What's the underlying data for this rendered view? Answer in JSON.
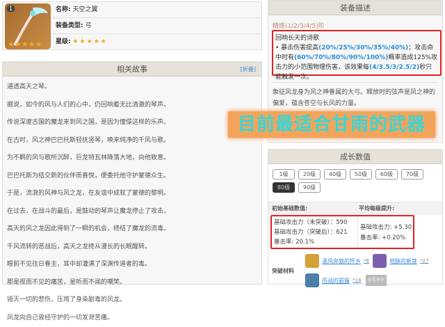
{
  "info": {
    "level_badge": "1",
    "name_label": "名称:",
    "name": "天空之翼",
    "type_label": "装备类型:",
    "type": "弓",
    "star_label": "星级:",
    "stars": "★★★★★",
    "icon": "sky-wing-bow-icon"
  },
  "story": {
    "title": "相关故事",
    "fold": "[折叠]",
    "lines": [
      "通透高天之琴。",
      "据说，如今的风与人们的心中，仍回响着无比清澈的琴声。",
      "传说深邃古国的魔龙来到风之国，是因为憧憬这样的乐声。",
      "在古时，风之神巴巴托斯轻抚竖琴，唤来纯净的千风与歌。",
      "为不羁的风与歌所沉醉，巨龙特瓦林降落大地，向他致意。",
      "巴巴托斯为结交新的伙伴而喜悦，便委托他守护蒙德众生。",
      "于是，流浪的风神与风之龙，在友谊中成就了蒙德的黎明。",
      "在过去，在战斗的最后，是鼓动的琴声让魔龙停止了攻击，",
      "高天的风之龙因此得到了一瞬的机会，终结了魔龙的流毒。",
      "千风流转的恶战后，高天之龙终从漫长的长眠醒转。",
      "眼前不见往日眷主，耳中却灌满了深渊传道者的毒。",
      "那是视而不见的痛苦，是听而不闻的嘲笑。",
      "毁灭一切的悲伤，压垮了身染剧毒的风龙。",
      "风龙向自己曾经守护的一切发泄苦痛。"
    ]
  },
  "desc": {
    "title": "装备描述",
    "refine": "精炼(1/2/3/4/5)阶",
    "skill_name": "回响长天的诗歌",
    "t1": "• 暴击伤害提高",
    "v1": "(20%/25%/30%/35%/40%)",
    "t2": "；攻击命中时有",
    "v2": "(60%/70%/80%/90%/100%)",
    "t3": "概率造成125%攻击力的小范围物理伤害，该效果每",
    "v3": "(4/3.5/3/2.5/2)",
    "t4": "秒只能触发一次。",
    "lore": "象征风龙身为风之神眷属的大弓。释放时的弦声是风之神的偏爱，蕴含苍空与长风的力量。"
  },
  "banner": "目前最适合甘雨的武器",
  "growth": {
    "title": "成长数值",
    "levels": [
      "1级",
      "20级",
      "40级",
      "50级",
      "60级",
      "70级",
      "80级",
      "90级"
    ],
    "selected": "80级",
    "base_header": "初始基础数值:",
    "avg_header": "平均每级提升:",
    "base": [
      "基础攻击力（未突破）：590",
      "基础攻击力（突破后）：621",
      "暴击率: 20.1%"
    ],
    "avg": [
      "基础攻击力: +5.30",
      "暴击率: +0.20%"
    ],
    "mat_label": "突破材料",
    "materials": [
      {
        "name": "凛风奔狼的怀乡",
        "count": "*6",
        "color": "#d4a03a"
      },
      {
        "name": "地脉的新芽",
        "count": "*27",
        "color": "#7a5fae"
      },
      {
        "name": "历战的箭簇",
        "count": "*18",
        "color": "#4d7fa8"
      }
    ],
    "more": "查看更多"
  }
}
